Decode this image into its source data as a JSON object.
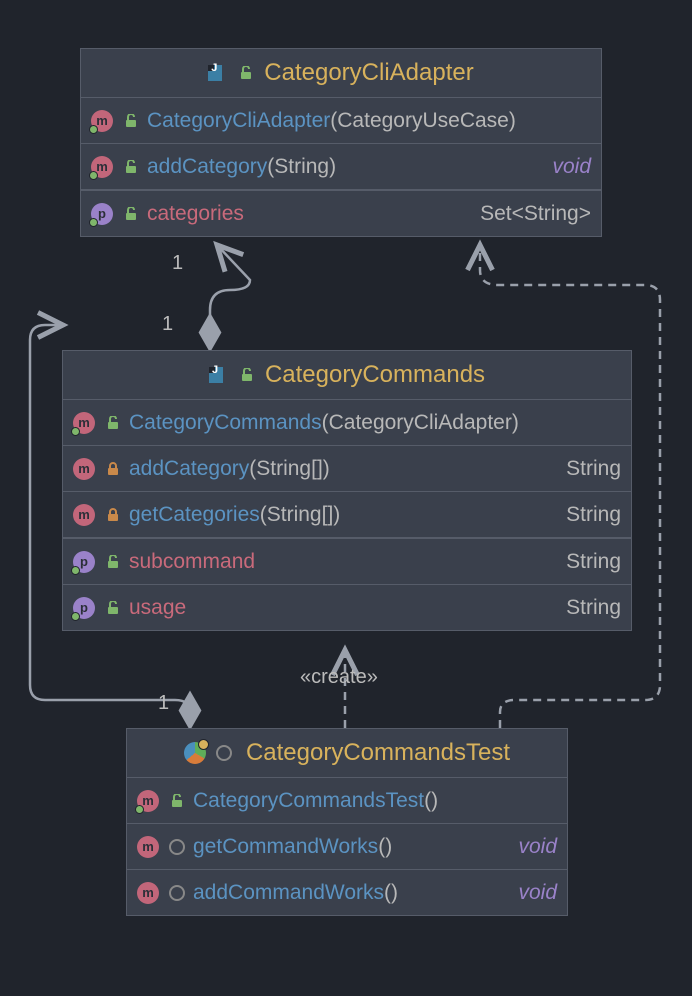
{
  "classes": {
    "adapter": {
      "title": "CategoryCliAdapter",
      "rows": [
        {
          "kind": "m",
          "vis": "open",
          "nameBlue": "CategoryCliAdapter",
          "paren": "(",
          "arg": "CategoryUseCase",
          "close": ")",
          "ret": ""
        },
        {
          "kind": "m",
          "vis": "open",
          "nameBlue": "addCategory",
          "paren": "(",
          "arg": "String",
          "close": ")",
          "ret": "void",
          "retStyle": "void"
        },
        {
          "kind": "p",
          "vis": "open",
          "namePink": "categories",
          "ret": "Set<String>",
          "retStyle": "type"
        }
      ]
    },
    "commands": {
      "title": "CategoryCommands",
      "rows": [
        {
          "kind": "m",
          "vis": "open",
          "nameBlue": "CategoryCommands",
          "paren": "(",
          "arg": "CategoryCliAdapter",
          "close": ")",
          "ret": ""
        },
        {
          "kind": "m",
          "vis": "lock",
          "nameBlue": "addCategory",
          "paren": "(",
          "arg": "String[]",
          "close": ")",
          "ret": "String",
          "retStyle": "type"
        },
        {
          "kind": "m",
          "vis": "lock",
          "nameBlue": "getCategories",
          "paren": "(",
          "arg": "String[]",
          "close": ")",
          "ret": "String",
          "retStyle": "type"
        },
        {
          "kind": "p",
          "vis": "open",
          "namePink": "subcommand",
          "ret": "String",
          "retStyle": "type"
        },
        {
          "kind": "p",
          "vis": "open",
          "namePink": "usage",
          "ret": "String",
          "retStyle": "type"
        }
      ]
    },
    "test": {
      "title": "CategoryCommandsTest",
      "rows": [
        {
          "kind": "m",
          "vis": "open",
          "nameBlue": "CategoryCommandsTest",
          "paren": "(",
          "arg": "",
          "close": ")",
          "ret": ""
        },
        {
          "kind": "m",
          "vis": "ring",
          "nameBlue": "getCommandWorks",
          "paren": "(",
          "arg": "",
          "close": ")",
          "ret": "void",
          "retStyle": "void"
        },
        {
          "kind": "m",
          "vis": "ring",
          "nameBlue": "addCommandWorks",
          "paren": "(",
          "arg": "",
          "close": ")",
          "ret": "void",
          "retStyle": "void"
        }
      ]
    }
  },
  "labels": {
    "mult_top": "1",
    "mult_mid": "1",
    "mult_bot": "1",
    "create": "«create»"
  }
}
